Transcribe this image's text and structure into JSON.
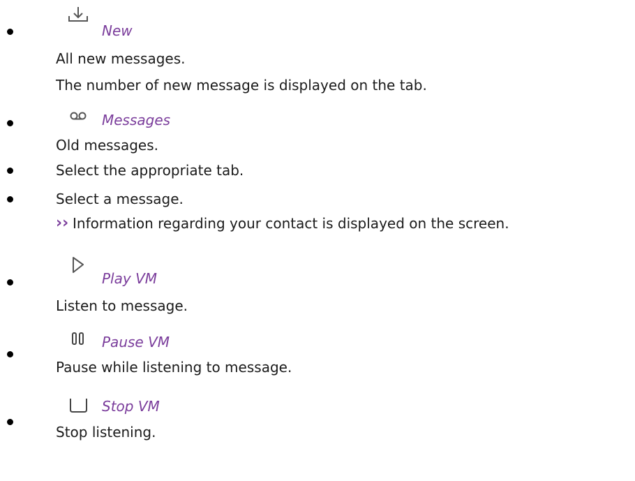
{
  "items": [
    {
      "icon": "download-tray-icon",
      "term": "New",
      "lines": [
        "All new messages.",
        "The number of new message is displayed on the tab."
      ]
    },
    {
      "icon": "voicemail-icon",
      "term": "Messages",
      "lines": [
        "Old messages."
      ]
    },
    {
      "text": "Select the appropriate tab."
    },
    {
      "text": "Select a message.",
      "result": "Information regarding your contact is displayed on the screen."
    },
    {
      "icon": "play-icon",
      "term": "Play VM",
      "lines": [
        "Listen to message."
      ]
    },
    {
      "icon": "pause-icon",
      "term": "Pause VM",
      "lines": [
        "Pause while listening to message."
      ]
    },
    {
      "icon": "stop-icon",
      "term": "Stop VM",
      "lines": [
        "Stop listening."
      ]
    }
  ],
  "colors": {
    "term": "#7a3c9b",
    "text": "#1a1a1a",
    "bullet": "#000000"
  },
  "result_marker": "››"
}
